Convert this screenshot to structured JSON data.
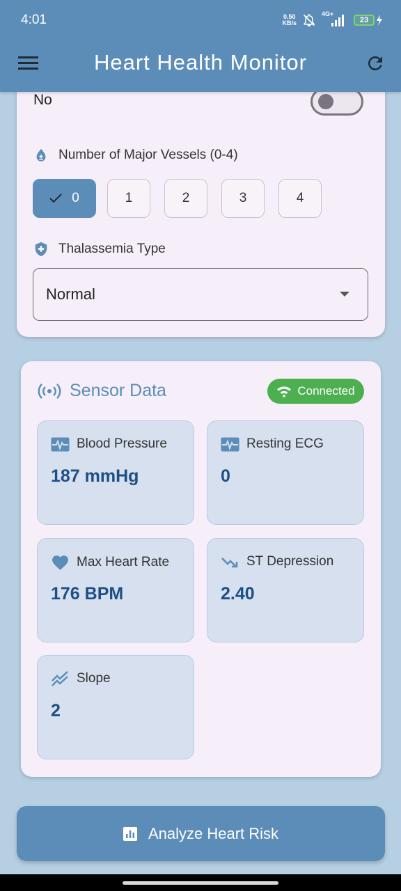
{
  "status_bar": {
    "time": "4:01",
    "net_speed_value": "0.50",
    "net_speed_unit": "KB/s",
    "network": "4G+",
    "battery": "23"
  },
  "app_bar": {
    "title": "Heart Health Monitor",
    "menu_icon": "menu-icon",
    "refresh_icon": "refresh-icon"
  },
  "form": {
    "toggle_label": "No",
    "toggle_on": false,
    "vessels": {
      "label": "Number of Major Vessels (0-4)",
      "options": [
        "0",
        "1",
        "2",
        "3",
        "4"
      ],
      "selected": "0"
    },
    "thalassemia": {
      "label": "Thalassemia Type",
      "value": "Normal"
    }
  },
  "sensor": {
    "title": "Sensor Data",
    "status": "Connected",
    "tiles": [
      {
        "label": "Blood Pressure",
        "value": "187 mmHg",
        "icon": "monitor-heart-icon"
      },
      {
        "label": "Resting ECG",
        "value": "0",
        "icon": "monitor-heart-icon"
      },
      {
        "label": "Max Heart Rate",
        "value": "176 BPM",
        "icon": "heart-icon"
      },
      {
        "label": "ST Depression",
        "value": "2.40",
        "icon": "trending-down-icon"
      },
      {
        "label": "Slope",
        "value": "2",
        "icon": "stacked-line-chart-icon"
      }
    ]
  },
  "actions": {
    "analyze_label": "Analyze Heart Risk"
  },
  "colors": {
    "primary": "#5b8db8",
    "background": "#b6cfe3",
    "card": "#f6eef8",
    "tile": "#d6e0ee",
    "value_text": "#1d4f86",
    "connected": "#4caf50"
  }
}
